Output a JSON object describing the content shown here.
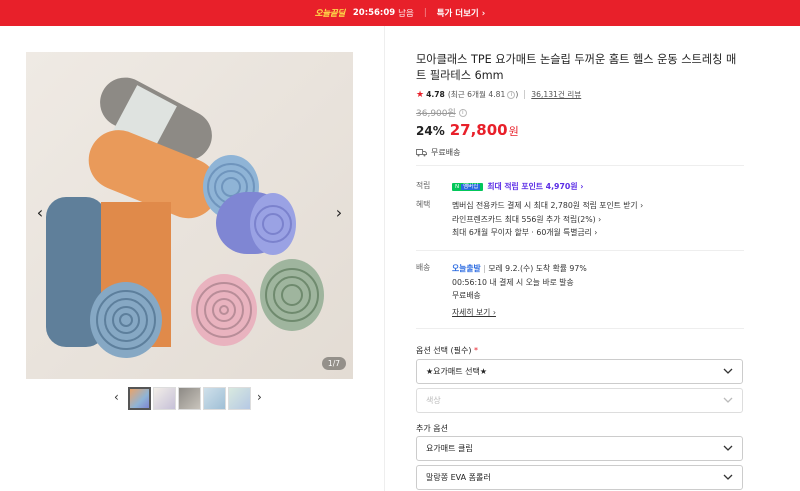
{
  "promo_bar": {
    "badge": "오늘끝딜",
    "timer": "20:56:09",
    "timer_suffix": "남음",
    "link": "특가 더보기 ›"
  },
  "gallery": {
    "counter": "1/7",
    "prev_icon": "chevron-left-icon",
    "next_icon": "chevron-right-icon",
    "thumbnails": [
      "thumb-1",
      "thumb-2",
      "thumb-3",
      "thumb-4",
      "thumb-5"
    ]
  },
  "product": {
    "title": "모아클래스 TPE 요가매트 논슬립 두꺼운 홈트 헬스 운동 스트레칭 매트 필라테스 6mm",
    "rating": "4.78",
    "recent_rating": "(최근 6개월 4.81",
    "reviews": "36,131건 리뷰",
    "original_price": "36,900원",
    "discount": "24%",
    "price": "27,800",
    "currency": "원",
    "shipping": "무료배송"
  },
  "benefits": {
    "point_label": "적립",
    "npay_badge": "N",
    "npay_badge2": "멤버십",
    "point_text": "최대 적립 포인트 4,970원 ›",
    "benefit_label": "혜택",
    "benefit_lines": [
      "멤버십 전용카드 결제 시 최대 2,780원 적립 포인트 받기 ›",
      "라인프렌즈카드 최대 556원 추가 적립(2%) ›",
      "최대 6개월 무이자 할부 · 60개월 특별금리 ›"
    ]
  },
  "delivery": {
    "label": "배송",
    "today_tag": "오늘출발",
    "arrival": "모레 9.2.(수) 도착 확률 97%",
    "cutoff": "00:56:10  내 결제 시 오늘 바로 발송",
    "fee": "무료배송",
    "details_link": "자세히 보기 ›"
  },
  "options": {
    "required_label": "옵션 선택 (필수)",
    "required_mark": "*",
    "select1": "★요가매트 선택★",
    "select2": "색상",
    "extra_label": "추가 옵션",
    "select3": "요가매트 클립",
    "select4": "말랑쫑 EVA 폼롤러"
  },
  "colors": {
    "accent": "#e8202a",
    "point": "#5b2de6",
    "today": "#2a6ae0"
  }
}
